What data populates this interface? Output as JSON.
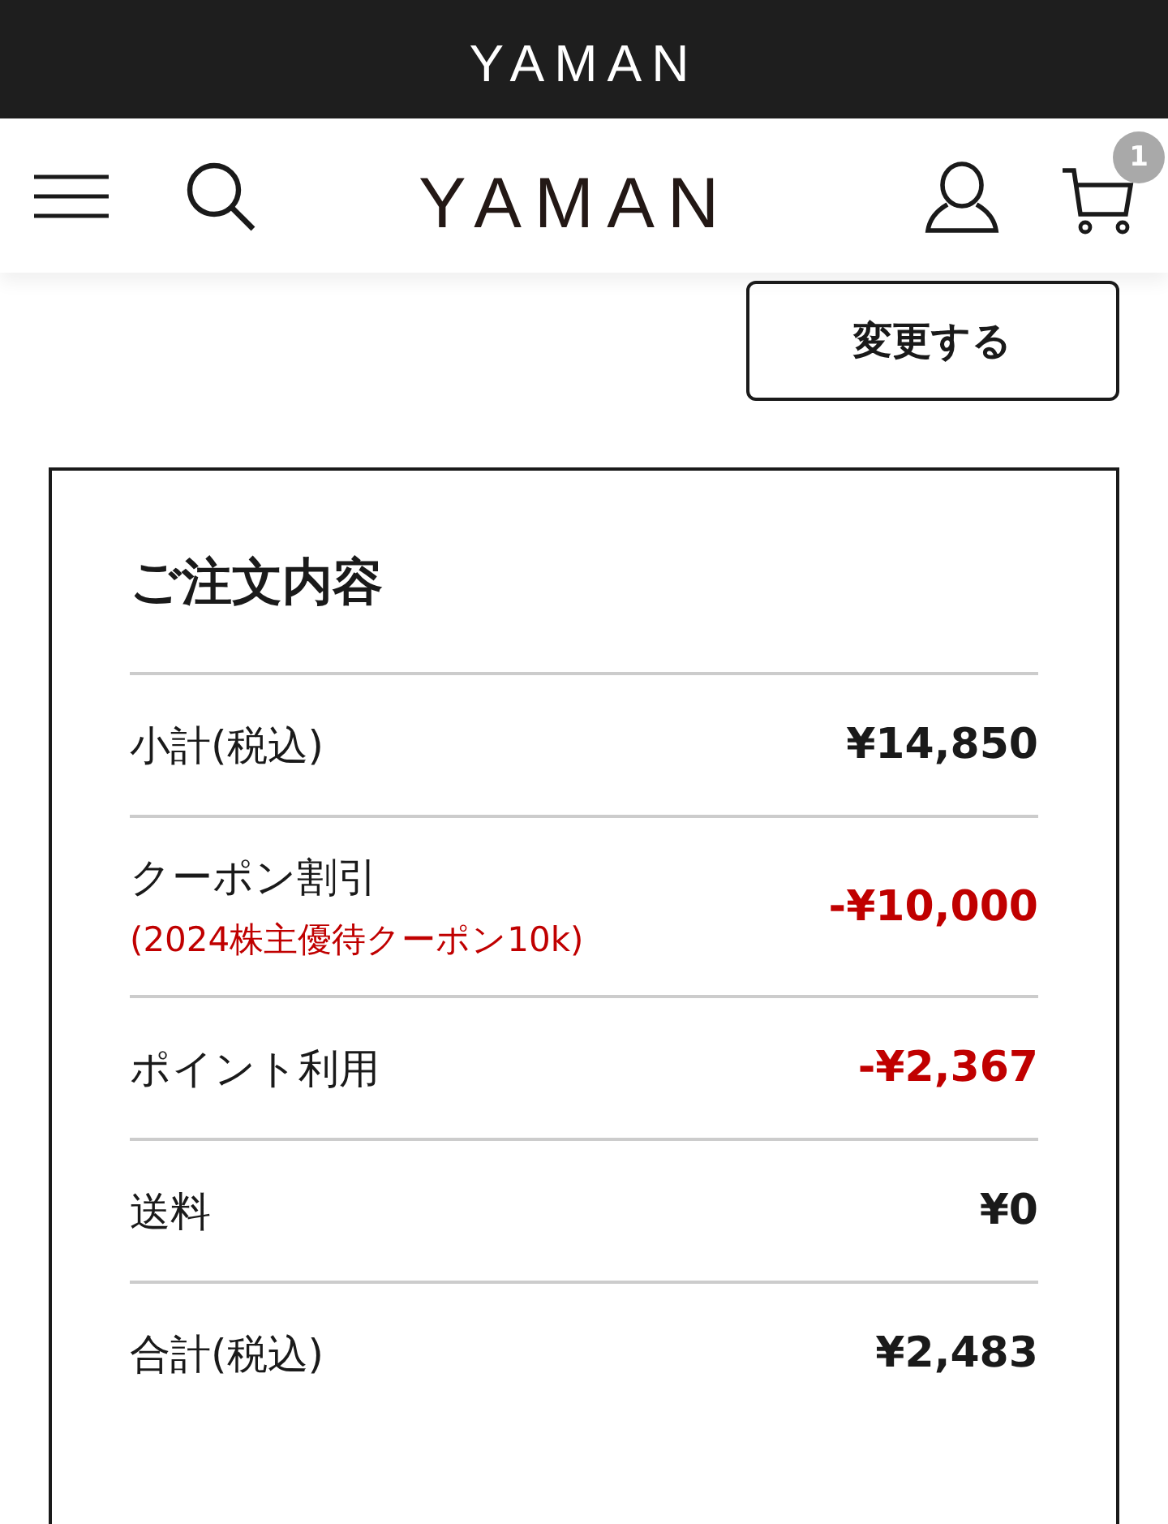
{
  "top_bar": {
    "logo": "YAMAN"
  },
  "header": {
    "logo": "YAMAN",
    "cart_count": "1"
  },
  "change_button": "変更する",
  "order_summary": {
    "title": "ご注文内容",
    "rows": [
      {
        "kind": "charge",
        "label": "小計(税込)",
        "value": "¥14,850"
      },
      {
        "kind": "discount",
        "label": "クーポン割引",
        "note": "(2024株主優待クーポン10k)",
        "value": "-¥10,000"
      },
      {
        "kind": "discount",
        "label": "ポイント利用",
        "value": "-¥2,367"
      },
      {
        "kind": "charge",
        "label": "送料",
        "value": "¥0"
      },
      {
        "kind": "charge",
        "label": "合計(税込)",
        "value": "¥2,483"
      }
    ]
  }
}
